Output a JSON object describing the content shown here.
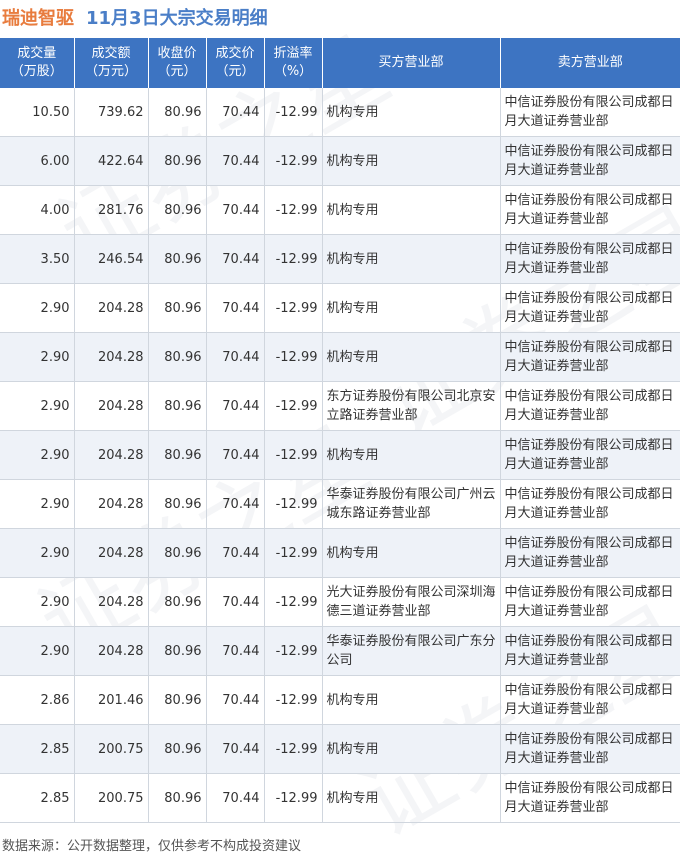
{
  "title": {
    "stock": "瑞迪智驱",
    "rest": "11月3日大宗交易明细"
  },
  "columns": [
    "成交量\n（万股）",
    "成交额\n（万元）",
    "收盘价\n（元）",
    "成交价\n（元）",
    "折溢率\n（%）",
    "买方营业部",
    "卖方营业部"
  ],
  "rows": [
    [
      "10.50",
      "739.62",
      "80.96",
      "70.44",
      "-12.99",
      "机构专用",
      "中信证券股份有限公司成都日月大道证券营业部"
    ],
    [
      "6.00",
      "422.64",
      "80.96",
      "70.44",
      "-12.99",
      "机构专用",
      "中信证券股份有限公司成都日月大道证券营业部"
    ],
    [
      "4.00",
      "281.76",
      "80.96",
      "70.44",
      "-12.99",
      "机构专用",
      "中信证券股份有限公司成都日月大道证券营业部"
    ],
    [
      "3.50",
      "246.54",
      "80.96",
      "70.44",
      "-12.99",
      "机构专用",
      "中信证券股份有限公司成都日月大道证券营业部"
    ],
    [
      "2.90",
      "204.28",
      "80.96",
      "70.44",
      "-12.99",
      "机构专用",
      "中信证券股份有限公司成都日月大道证券营业部"
    ],
    [
      "2.90",
      "204.28",
      "80.96",
      "70.44",
      "-12.99",
      "机构专用",
      "中信证券股份有限公司成都日月大道证券营业部"
    ],
    [
      "2.90",
      "204.28",
      "80.96",
      "70.44",
      "-12.99",
      "东方证券股份有限公司北京安立路证券营业部",
      "中信证券股份有限公司成都日月大道证券营业部"
    ],
    [
      "2.90",
      "204.28",
      "80.96",
      "70.44",
      "-12.99",
      "机构专用",
      "中信证券股份有限公司成都日月大道证券营业部"
    ],
    [
      "2.90",
      "204.28",
      "80.96",
      "70.44",
      "-12.99",
      "华泰证券股份有限公司广州云城东路证券营业部",
      "中信证券股份有限公司成都日月大道证券营业部"
    ],
    [
      "2.90",
      "204.28",
      "80.96",
      "70.44",
      "-12.99",
      "机构专用",
      "中信证券股份有限公司成都日月大道证券营业部"
    ],
    [
      "2.90",
      "204.28",
      "80.96",
      "70.44",
      "-12.99",
      "光大证券股份有限公司深圳海德三道证券营业部",
      "中信证券股份有限公司成都日月大道证券营业部"
    ],
    [
      "2.90",
      "204.28",
      "80.96",
      "70.44",
      "-12.99",
      "华泰证券股份有限公司广东分公司",
      "中信证券股份有限公司成都日月大道证券营业部"
    ],
    [
      "2.86",
      "201.46",
      "80.96",
      "70.44",
      "-12.99",
      "机构专用",
      "中信证券股份有限公司成都日月大道证券营业部"
    ],
    [
      "2.85",
      "200.75",
      "80.96",
      "70.44",
      "-12.99",
      "机构专用",
      "中信证券股份有限公司成都日月大道证券营业部"
    ],
    [
      "2.85",
      "200.75",
      "80.96",
      "70.44",
      "-12.99",
      "机构专用",
      "中信证券股份有限公司成都日月大道证券营业部"
    ]
  ],
  "footer": "数据来源：公开数据整理，仅供参考不构成投资建议",
  "watermark": "证券之星",
  "colors": {
    "header_bg": "#3d74c2",
    "stock_title": "#e87c3e",
    "title_text": "#4a7ec7",
    "negative": "#1a9b3a",
    "stripe": "#eef2f8"
  }
}
